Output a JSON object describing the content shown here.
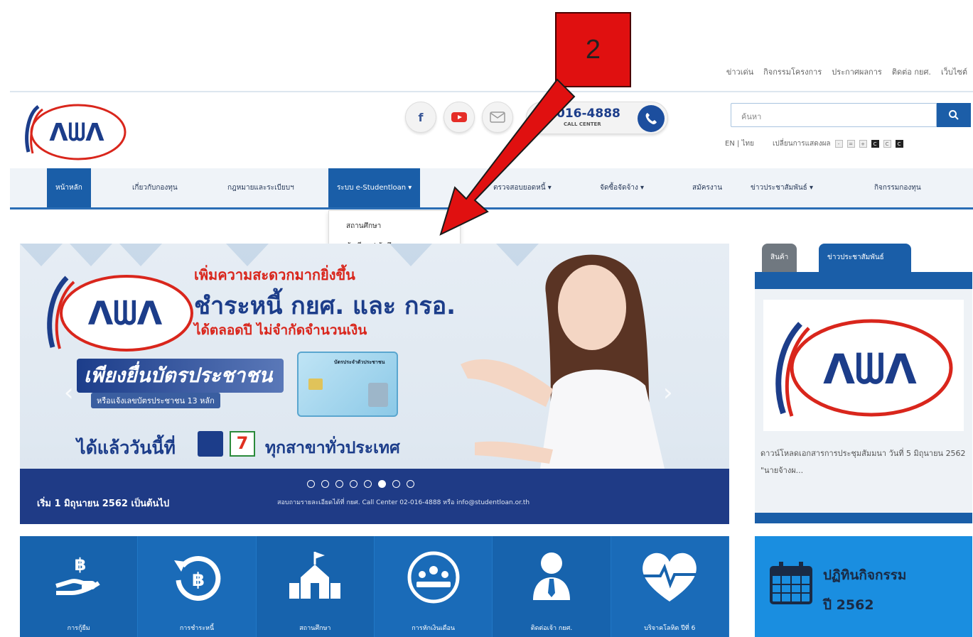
{
  "top_links": [
    "ข่าวเด่น",
    "กิจกรรมโครงการ",
    "ประกาศผลการ",
    "ติดต่อ กยศ.",
    "เว็บไซต์"
  ],
  "header": {
    "call_number": "016-4888",
    "call_label": "CALL CENTER",
    "search_placeholder": "ค้นหา",
    "lang": "EN | ไทย",
    "font_label": "เปลี่ยนการแสดงผล"
  },
  "nav": {
    "items": [
      "หน้าหลัก",
      "เกี่ยวกับกองทุน",
      "กฎหมายและระเบียบฯ",
      "ระบบ e-Studentloan ▾",
      "ตรวจสอบยอดหนี้ ▾",
      "จัดซื้อจัดจ้าง ▾",
      "สมัครงาน",
      "ข่าวประชาสัมพันธ์ ▾",
      "กิจกรรมกองทุน"
    ],
    "dropdown": [
      "สถานศึกษา",
      "นักเรียน / นักศึกษา"
    ]
  },
  "annotation": {
    "step": "2",
    "color": "#e01010"
  },
  "banner": {
    "line1": "เพิ่มความสะดวกมากยิ่งขึ้น",
    "line2": "ชำระหนี้ กยศ. และ กรอ.",
    "line3": "ได้ตลอดปี ไม่จำกัดจำนวนเงิน",
    "line4": "เพียงยื่นบัตรประชาชน",
    "line5": "หรือแจ้งเลขบัตรประชาชน 13 หลัก",
    "line6": "ได้แล้ววันนี้ที่",
    "line7": "ทุกสาขาทั่วประเทศ",
    "idcard_title": "บัตรประจำตัวประชาชน",
    "footer_left": "เริ่ม 1 มิถุนายน 2562 เป็นต้นไป",
    "footer_right": "สอบถามรายละเอียดได้ที่ กยศ. Call Center 02-016-4888 หรือ info@studentloan.or.th",
    "slide_count": 8,
    "active_slide": 6
  },
  "right_panel": {
    "tabs": [
      "สินค้า",
      "ข่าวประชาสัมพันธ์"
    ],
    "news": "ดาวน์โหลดเอกสารการประชุมสัมมนา วันที่ 5 มิถุนายน 2562 \"นายจ้างผ...",
    "activity_line1": "ปฏิทินกิจกรรม",
    "activity_line2": "ปี 2562"
  },
  "tiles": [
    "การกู้ยืม",
    "การชำระหนี้",
    "สถานศึกษา",
    "การหักเงินเดือน",
    "ติดต่อเจ้า กยศ.",
    "บริจาคโลหิต ปีที่ 6"
  ],
  "colors": {
    "brand_blue": "#1a5ea8",
    "brand_red": "#d9261c",
    "navy": "#1f3b86"
  }
}
